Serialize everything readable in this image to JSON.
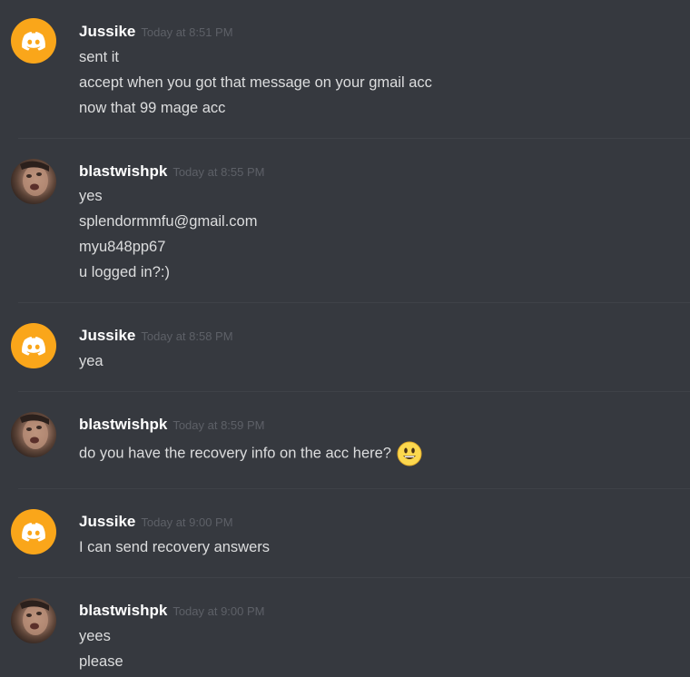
{
  "messages": [
    {
      "author": "Jussike",
      "timestamp": "Today at 8:51 PM",
      "avatar": "discord-logo-icon",
      "lines": [
        "sent it",
        "accept when you got that message on your gmail acc",
        "now that 99 mage acc"
      ]
    },
    {
      "author": "blastwishpk",
      "timestamp": "Today at 8:55 PM",
      "avatar": "user-photo",
      "lines": [
        "yes",
        "splendormmfu@gmail.com",
        "myu848pp67",
        "u logged in?:)"
      ]
    },
    {
      "author": "Jussike",
      "timestamp": "Today at 8:58 PM",
      "avatar": "discord-logo-icon",
      "lines": [
        "yea"
      ]
    },
    {
      "author": "blastwishpk",
      "timestamp": "Today at 8:59 PM",
      "avatar": "user-photo",
      "lines": [
        "do you have the recovery info on the acc here?"
      ],
      "emoji": "smiley-face-icon"
    },
    {
      "author": "Jussike",
      "timestamp": "Today at 9:00 PM",
      "avatar": "discord-logo-icon",
      "lines": [
        "I can send recovery answers"
      ]
    },
    {
      "author": "blastwishpk",
      "timestamp": "Today at 9:00 PM",
      "avatar": "user-photo",
      "lines": [
        "yees",
        "please"
      ]
    }
  ],
  "colors": {
    "background": "#36393f",
    "divider": "#3f4248",
    "username": "#ffffff",
    "timestamp": "#5d6067",
    "message_text": "#dcddde",
    "discord_avatar": "#faa61a"
  }
}
